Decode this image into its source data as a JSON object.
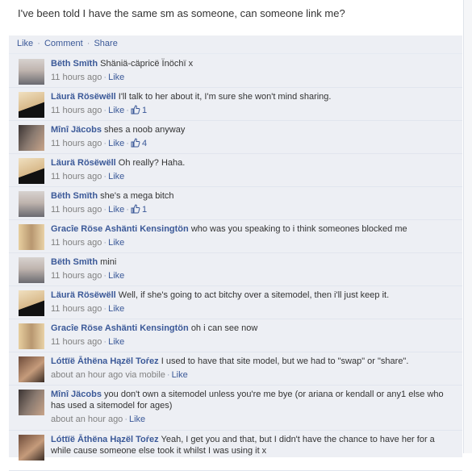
{
  "post": {
    "text": "I've been told I have the same sm as someone, can someone link me?"
  },
  "actions": {
    "like": "Like",
    "comment": "Comment",
    "share": "Share",
    "sep": "·"
  },
  "comments": [
    {
      "author": "Bëth Smïth",
      "text": "Shäniä-cäpricë Ïnöchï x",
      "time": "11 hours ago",
      "like": "Like",
      "likes": "",
      "avatar": "blonde-girl"
    },
    {
      "author": "Läurä Rösëwëll",
      "text": "I'll talk to her about it, I'm sure she won't mind sharing.",
      "time": "11 hours ago",
      "like": "Like",
      "likes": "1",
      "avatar": "blonde-shirt"
    },
    {
      "author": "Mînî Jäcobs",
      "text": "shes a noob anyway",
      "time": "11 hours ago",
      "like": "Like",
      "likes": "4",
      "avatar": "couple"
    },
    {
      "author": "Läurä Rösëwëll",
      "text": "Oh really? Haha.",
      "time": "11 hours ago",
      "like": "Like",
      "likes": "",
      "avatar": "blonde-shirt"
    },
    {
      "author": "Bëth Smïth",
      "text": "she's a mega bitch",
      "time": "11 hours ago",
      "like": "Like",
      "likes": "1",
      "avatar": "blonde-girl"
    },
    {
      "author": "Gracîe Röse Ashänti Kensingtön",
      "text": "who was you speaking to i think someones blocked me",
      "time": "11 hours ago",
      "like": "Like",
      "likes": "",
      "avatar": "two-blondes"
    },
    {
      "author": "Bëth Smïth",
      "text": "mini",
      "time": "11 hours ago",
      "like": "Like",
      "likes": "",
      "avatar": "blonde-girl"
    },
    {
      "author": "Läurä Rösëwëll",
      "text": "Well, if she's going to act bitchy over a sitemodel, then i'll just keep it.",
      "time": "11 hours ago",
      "like": "Like",
      "likes": "",
      "avatar": "blonde-shirt"
    },
    {
      "author": "Gracîe Röse Ashänti Kensingtön",
      "text": "oh i can see now",
      "time": "11 hours ago",
      "like": "Like",
      "likes": "",
      "avatar": "two-blondes"
    },
    {
      "author": "Lóttïë Āthëna Hązël Toŕez",
      "text": "I used to have that site model, but we had to \"swap\" or \"share\".",
      "time": "about an hour ago via mobile",
      "like": "Like",
      "likes": "",
      "avatar": "selfie"
    },
    {
      "author": "Mînî Jäcobs",
      "text": "you don't own a sitemodel unless you're me bye (or ariana or kendall or any1 else who has used a sitemodel for ages)",
      "time": "about an hour ago",
      "like": "Like",
      "likes": "",
      "avatar": "couple"
    },
    {
      "author": "Lóttïë Āthëna Hązël Toŕez",
      "text": "Yeah, I get you and that, but I didn't have the chance to have her for a while cause someone else took it whilst I was using it x",
      "time": "",
      "like": "",
      "likes": "",
      "avatar": "selfie"
    }
  ]
}
